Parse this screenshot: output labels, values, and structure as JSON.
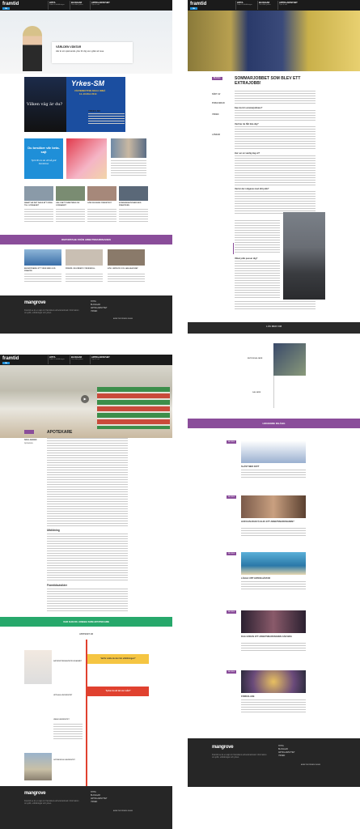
{
  "header": {
    "logo": "framtid",
    "logo_sub": "nu",
    "nav": [
      {
        "title": "HITTA",
        "sub": "Jobb & utbildningar"
      },
      {
        "title": "BLOGGAR",
        "sub": "Om olika yrken"
      },
      {
        "title": "ARTIKLAR/NYHET",
        "sub": "Tips & råd"
      }
    ]
  },
  "home": {
    "hero_title": "VÄRLDEN VÄNTAR",
    "hero_text": "Här är ett spännande yrke för dig som gillar att resa.",
    "promo_title": "Yrkes-SM",
    "promo_place": "VÄSTERBOTTEN NOLIA UMEÅ",
    "promo_date": "14–16 MAJ 2014",
    "promo_caption": "Vilken väg är du?",
    "event_title": "YRKES-SM",
    "blue_box": "Du besöker vår beta-sajt",
    "blue_box_sub": "Tyck till om du vill så gott framtid.se",
    "grid_captions": [
      "SNART ÄR DET DAGS ATT SÖKA TILL GYMNASIET",
      "VÄLJ RÄTT INRIKTNING PÅ GYMNASIET",
      "GÖR DIN EGEN YRKESTEST",
      "KOMMUNIKATIONER MED FRAMTIDEN"
    ],
    "reportage_band": "REPORTAGE FRÅN ARBETSMARKNADEN",
    "reportage_captions": [
      "BUSSFÖRARE: ETT YRKE MED GOD FRAMTID",
      "FRISÖR: EN KREATIV YRKESROLL",
      "KÖK: SERVICE OCH HÅLLBAR MAT"
    ]
  },
  "article": {
    "badge": "BLOGG",
    "title": "SOMMARJOBBET SOM BLEV ETT EXTRAJOBB!",
    "meta": [
      "SÖKT AV",
      "PUBLICERAD",
      "YRKEN",
      "LÄNKAR"
    ],
    "quote": "Kan du bli sommarjobbare?",
    "questions": [
      "Vad har du fått lära dig?",
      "Hur ser en vanlig dag ut?",
      "Vad är det roligaste med ditt jobb?",
      "Vilket jobb passar dig?"
    ],
    "more_band": "LÄS MER OM",
    "more_items": [
      "BUTIKSSÄLJARE",
      "SÄLJARE"
    ]
  },
  "profession": {
    "title": "APOTEKARE",
    "meta": [
      "SKILLNADEN",
      "Apotekare"
    ],
    "sections": [
      "Utbildning",
      "Framtidsutsikter"
    ],
    "band": "VAR KAN DU JOBBA SOM APOTEKARE",
    "timeline_head": "APOTEKET AB",
    "timeline": [
      {
        "label": "NATURVETENSKAPSPROGRAMMET",
        "card": "Varför valde du den här utbildningen?"
      },
      {
        "label": "UPPSALA UNIVERSITET",
        "card": "Tycker du att det var svårt?"
      },
      {
        "label": "UMEÅ UNIVERSITET",
        "card": ""
      },
      {
        "label": "GÖTEBORGS UNIVERSITET",
        "card": ""
      }
    ]
  },
  "related": {
    "band": "LIKNANDE INLÄGG",
    "badge": "BLOGG",
    "items": [
      {
        "title": "SLÅST MED DATT",
        "color": "#5a7fae"
      },
      {
        "title": "HUR KAN MAN FÅ ELEV ETT ARBETSMARKNADEN?",
        "color": "#b8876a"
      },
      {
        "title": "LÄGGA UPP ANTEN HÄSTAR",
        "color": "#3d8fb8"
      },
      {
        "title": "DAG GÖRAN ETT ARBETSMARKNADEN GÅR BRA",
        "color": "#4a3a4a"
      },
      {
        "title": "FÖRKOLADE",
        "color": "#7a5a6b"
      }
    ]
  },
  "footer": {
    "logo": "mangrove",
    "links": [
      "HITTA",
      "BLOGGAR",
      "ARTIKLAR/NYHET",
      "YRKEN"
    ],
    "text": "Framtid.se är en sajt om framtidens arbetsmarknad. Information om jobb, utbildningar och yrken.",
    "partner": "ARBETSFÖRMEDLINGEN"
  },
  "colors": {
    "purple": "#8a4d9a",
    "green": "#27a86b",
    "blue": "#1f8fd8",
    "dark": "#262626",
    "yellow": "#f5c542",
    "red": "#e0412f"
  }
}
